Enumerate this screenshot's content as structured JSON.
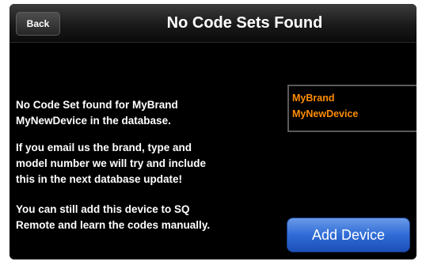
{
  "nav": {
    "back_label": "Back",
    "title": "No Code Sets Found"
  },
  "message": {
    "paragraph1_line1": "No Code Set found for MyBrand",
    "paragraph1_line2": "MyNewDevice in the database.",
    "paragraph2_line1": "If you email us the brand, type and",
    "paragraph2_line2": "model number we will try and include",
    "paragraph2_line3": "this in the next database update!",
    "paragraph3_line1": "You can still add this device to SQ",
    "paragraph3_line2": "Remote and learn the codes manually."
  },
  "device": {
    "brand": "MyBrand",
    "name": "MyNewDevice"
  },
  "actions": {
    "add_device_label": "Add Device"
  },
  "colors": {
    "device_text": "#ff8c00",
    "button_blue": "#2f6cd6",
    "background": "#000000"
  }
}
